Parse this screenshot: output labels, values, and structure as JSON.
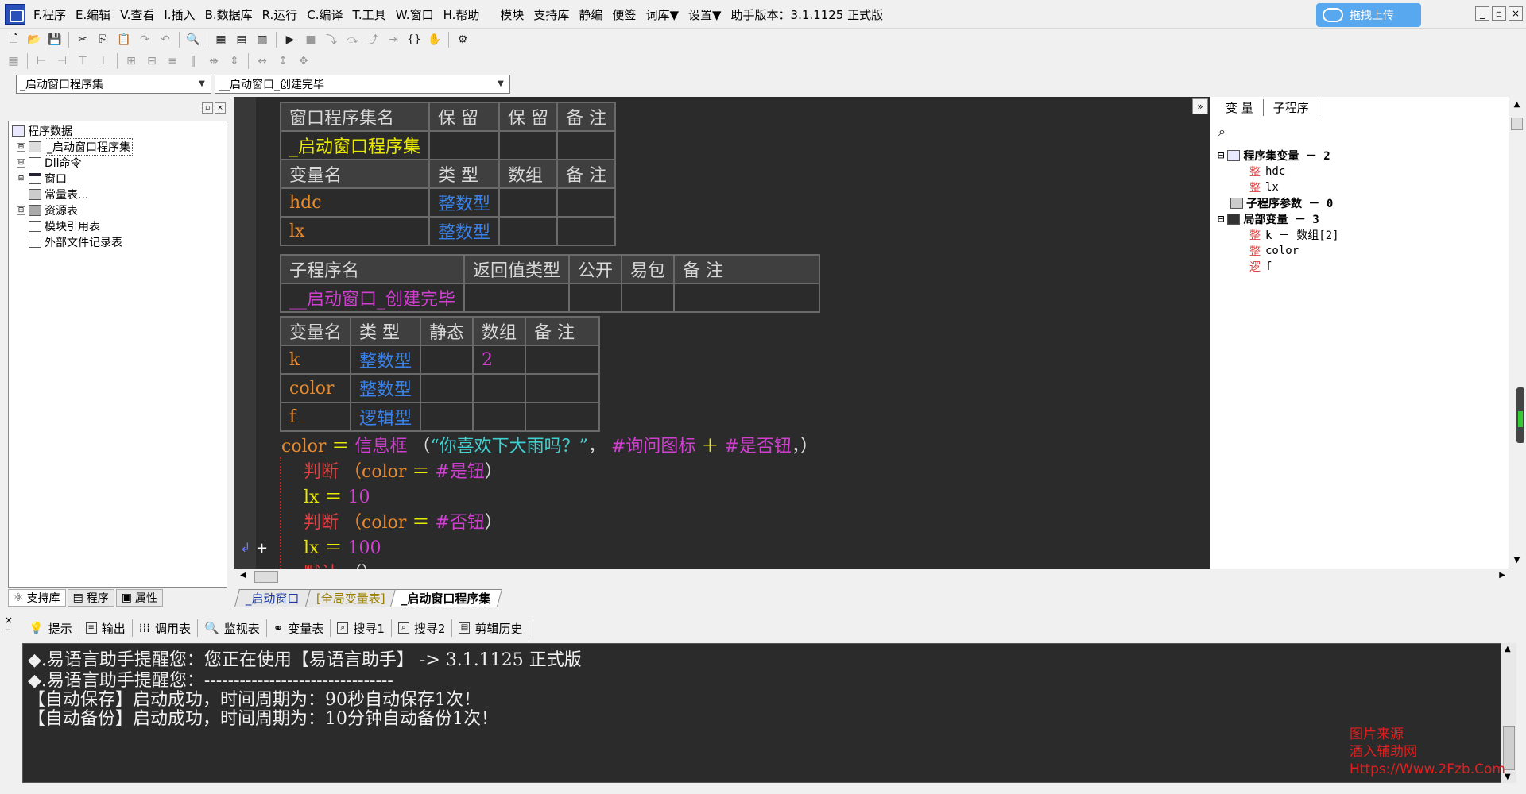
{
  "menubar": {
    "items": [
      "F.程序",
      "E.编辑",
      "V.查看",
      "I.插入",
      "B.数据库",
      "R.运行",
      "C.编译",
      "T.工具",
      "W.窗口",
      "H.帮助"
    ],
    "extra": [
      "模块",
      "支持库",
      "静编",
      "便签",
      "词库▼",
      "设置▼",
      "助手版本：3.1.1125 正式版"
    ],
    "upload_label": "拖拽上传",
    "win_buttons": [
      "_",
      "▫",
      "×"
    ]
  },
  "combos": {
    "left": "_启动窗口程序集",
    "right": "__启动窗口_创建完毕"
  },
  "left_tree": {
    "root": "程序数据",
    "items": [
      {
        "label": "_启动窗口程序集",
        "toggle": "⊞"
      },
      {
        "label": "Dll命令",
        "toggle": "⊞"
      },
      {
        "label": "窗口",
        "toggle": "⊞"
      },
      {
        "label": "常量表...",
        "toggle": ""
      },
      {
        "label": "资源表",
        "toggle": "⊞"
      },
      {
        "label": "模块引用表",
        "toggle": ""
      },
      {
        "label": "外部文件记录表",
        "toggle": ""
      }
    ],
    "tabs": [
      "支持库",
      "程序",
      "属性"
    ]
  },
  "editor": {
    "table1": {
      "header": [
        "窗口程序集名",
        "保 留",
        "保 留",
        "备 注"
      ],
      "name": "_启动窗口程序集",
      "var_header": [
        "变量名",
        "类 型",
        "数组",
        "备 注"
      ],
      "vars": [
        [
          "hdc",
          "整数型"
        ],
        [
          "lx",
          "整数型"
        ]
      ]
    },
    "table2": {
      "header": [
        "子程序名",
        "返回值类型",
        "公开",
        "易包",
        "备 注"
      ],
      "name": "__启动窗口_创建完毕",
      "var_header": [
        "变量名",
        "类 型",
        "静态",
        "数组",
        "备 注"
      ],
      "vars": [
        [
          "k",
          "整数型",
          "2"
        ],
        [
          "color",
          "整数型",
          ""
        ],
        [
          "f",
          "逻辑型",
          ""
        ]
      ]
    },
    "code": {
      "l1": {
        "a": "color",
        "b": "＝",
        "c": "信息框",
        "d": "（",
        "e": "“你喜欢下大雨吗？”",
        "f": "，",
        "g": "#询问图标",
        "h": "＋",
        "i": "#是否钮",
        "j": "，）"
      },
      "l2": {
        "kw": "判断",
        "a": "（color",
        "b": "＝",
        "c": "#是钮",
        "d": "）"
      },
      "l3": {
        "a": "lx",
        "b": "＝",
        "c": "10"
      },
      "l4": {
        "kw": "判断",
        "a": "（color",
        "b": "＝",
        "c": "#否钮",
        "d": "）"
      },
      "l5": {
        "a": "lx",
        "b": "＝",
        "c": "100"
      },
      "l6": {
        "kw": "默认",
        "a": "（）"
      }
    }
  },
  "right_panel": {
    "tabs": [
      "变 量",
      "子程序"
    ],
    "tree": [
      {
        "label": "程序集变量 － 2",
        "bold": true
      },
      {
        "label": "hdc",
        "icon": "整"
      },
      {
        "label": "lx",
        "icon": "整"
      },
      {
        "label": "子程序参数 － 0",
        "bold": true
      },
      {
        "label": "局部变量 － 3",
        "bold": true
      },
      {
        "label": "k － 数组[2]",
        "icon": "整"
      },
      {
        "label": "color",
        "icon": "整"
      },
      {
        "label": "f",
        "icon": "逻"
      }
    ]
  },
  "doc_tabs": [
    "_启动窗口",
    "[全局变量表]",
    "_启动窗口程序集"
  ],
  "bottom_tabs": [
    "提示",
    "输出",
    "调用表",
    "监视表",
    "变量表",
    "搜寻1",
    "搜寻2",
    "剪辑历史"
  ],
  "output": [
    "◆.易语言助手提醒您：您正在使用【易语言助手】 ->  3.1.1125 正式版",
    "◆.易语言助手提醒您：--------------------------------",
    "【自动保存】启动成功，时间周期为：90秒自动保存1次！",
    "【自动备份】启动成功，时间周期为：10分钟自动备份1次！"
  ],
  "watermark": [
    "图片来源",
    "酒入辅助网",
    "Https://Www.2Fzb.Com"
  ]
}
